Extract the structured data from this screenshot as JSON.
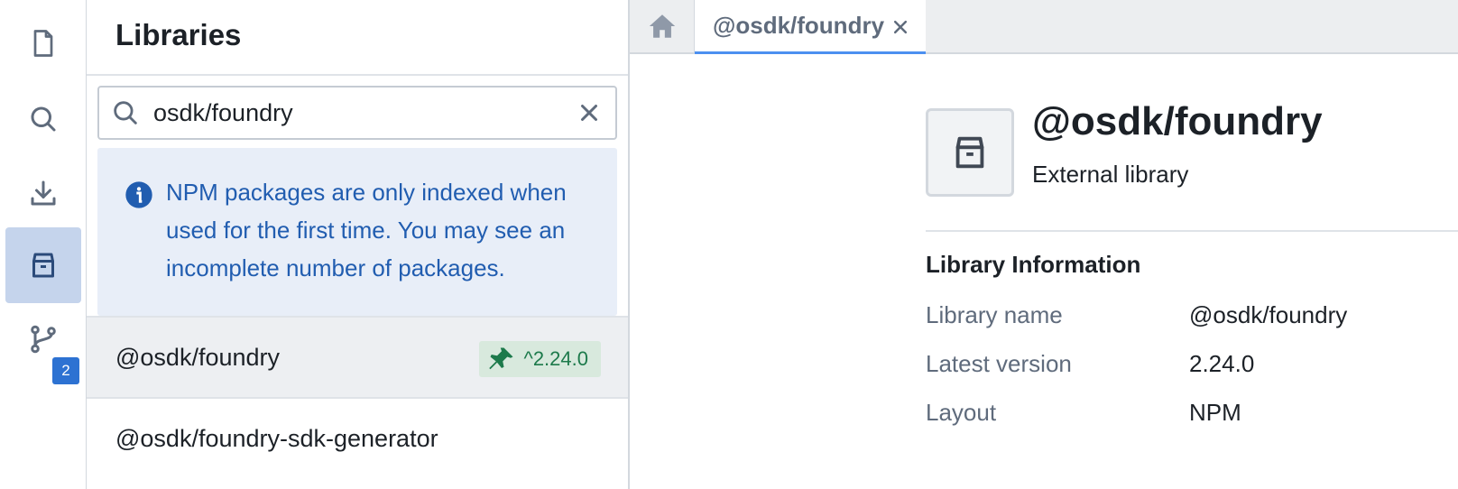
{
  "rail": {
    "items": [
      {
        "name": "files",
        "icon": "document-icon"
      },
      {
        "name": "search",
        "icon": "search-icon"
      },
      {
        "name": "import",
        "icon": "import-icon"
      },
      {
        "name": "libraries",
        "icon": "package-icon",
        "active": true
      },
      {
        "name": "branches",
        "icon": "git-branch-icon",
        "badge": "2"
      }
    ],
    "branch_badge": "2"
  },
  "libraries": {
    "title": "Libraries",
    "search": {
      "value": "osdk/foundry",
      "placeholder": ""
    },
    "callout": "NPM packages are only indexed when used for the first time. You may see an incomplete number of packages.",
    "results": [
      {
        "name": "@osdk/foundry",
        "version_tag": "^2.24.0",
        "selected": true
      },
      {
        "name": "@osdk/foundry-sdk-generator"
      }
    ]
  },
  "tabs": {
    "home_icon": "home-icon",
    "open": [
      {
        "label": "@osdk/foundry",
        "active": true
      }
    ]
  },
  "detail": {
    "title": "@osdk/foundry",
    "subtitle": "External library",
    "section_title": "Library Information",
    "rows": [
      {
        "key": "Library name",
        "value": "@osdk/foundry"
      },
      {
        "key": "Latest version",
        "value": "2.24.0"
      },
      {
        "key": "Layout",
        "value": "NPM"
      }
    ]
  },
  "colors": {
    "accent": "#2d72d2",
    "callout_text": "#215db0",
    "callout_bg": "#e8eef8",
    "tag_green": "#1d7a4b",
    "rail_active_bg": "#c5d4ec"
  }
}
